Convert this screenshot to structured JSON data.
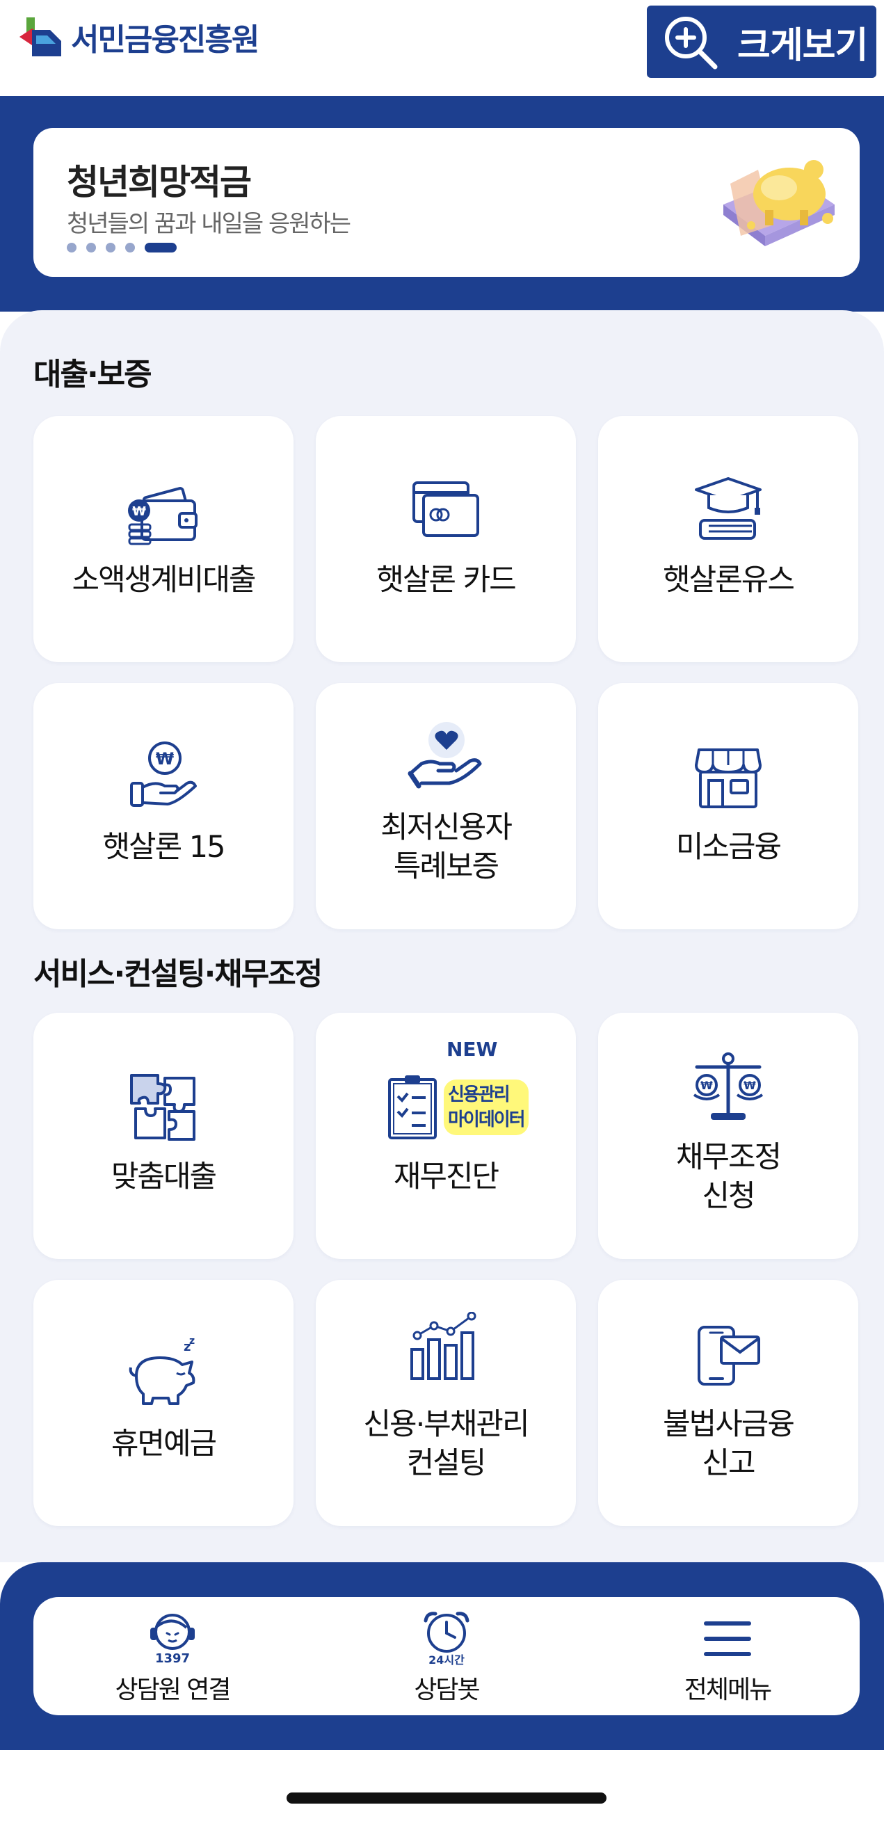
{
  "header": {
    "logo_text": "서민금융진흥원",
    "zoom_label": "크게보기"
  },
  "banner": {
    "title": "청년희망적금",
    "subtitle": "청년들의 꿈과 내일을 응원하는",
    "slide_count": 5,
    "active_slide": 5
  },
  "sections": {
    "loans": {
      "title": "대출·보증",
      "items": [
        {
          "label": "소액생계비대출",
          "icon": "wallet-coins-icon"
        },
        {
          "label": "햇살론 카드",
          "icon": "credit-card-icon"
        },
        {
          "label": "햇살론유스",
          "icon": "graduation-cap-icon"
        },
        {
          "label": "햇살론 15",
          "icon": "hand-coin-icon"
        },
        {
          "label": "최저신용자",
          "label2": "특례보증",
          "icon": "hand-heart-icon"
        },
        {
          "label": "미소금융",
          "icon": "store-icon"
        }
      ]
    },
    "services": {
      "title": "서비스·컨설팅·채무조정",
      "items": [
        {
          "label": "맞춤대출",
          "icon": "puzzle-icon"
        },
        {
          "label": "재무진단",
          "icon": "clipboard-check-icon",
          "badge": "NEW",
          "highlight1": "신용관리",
          "highlight2": "마이데이터"
        },
        {
          "label": "채무조정",
          "label2": "신청",
          "icon": "scale-icon"
        },
        {
          "label": "휴면예금",
          "icon": "piggy-bank-icon"
        },
        {
          "label": "신용·부채관리",
          "label2": "컨설팅",
          "icon": "bar-chart-icon"
        },
        {
          "label": "불법사금융",
          "label2": "신고",
          "icon": "phone-mail-icon"
        }
      ]
    }
  },
  "bottom_nav": {
    "consultant": {
      "label": "상담원 연결",
      "number": "1397"
    },
    "chatbot": {
      "label": "상담봇",
      "hours": "24시간"
    },
    "menu": {
      "label": "전체메뉴"
    }
  },
  "colors": {
    "brand_navy": "#1d3f8f",
    "background_gray": "#f0f2f9",
    "highlight_yellow": "#fff87a"
  }
}
